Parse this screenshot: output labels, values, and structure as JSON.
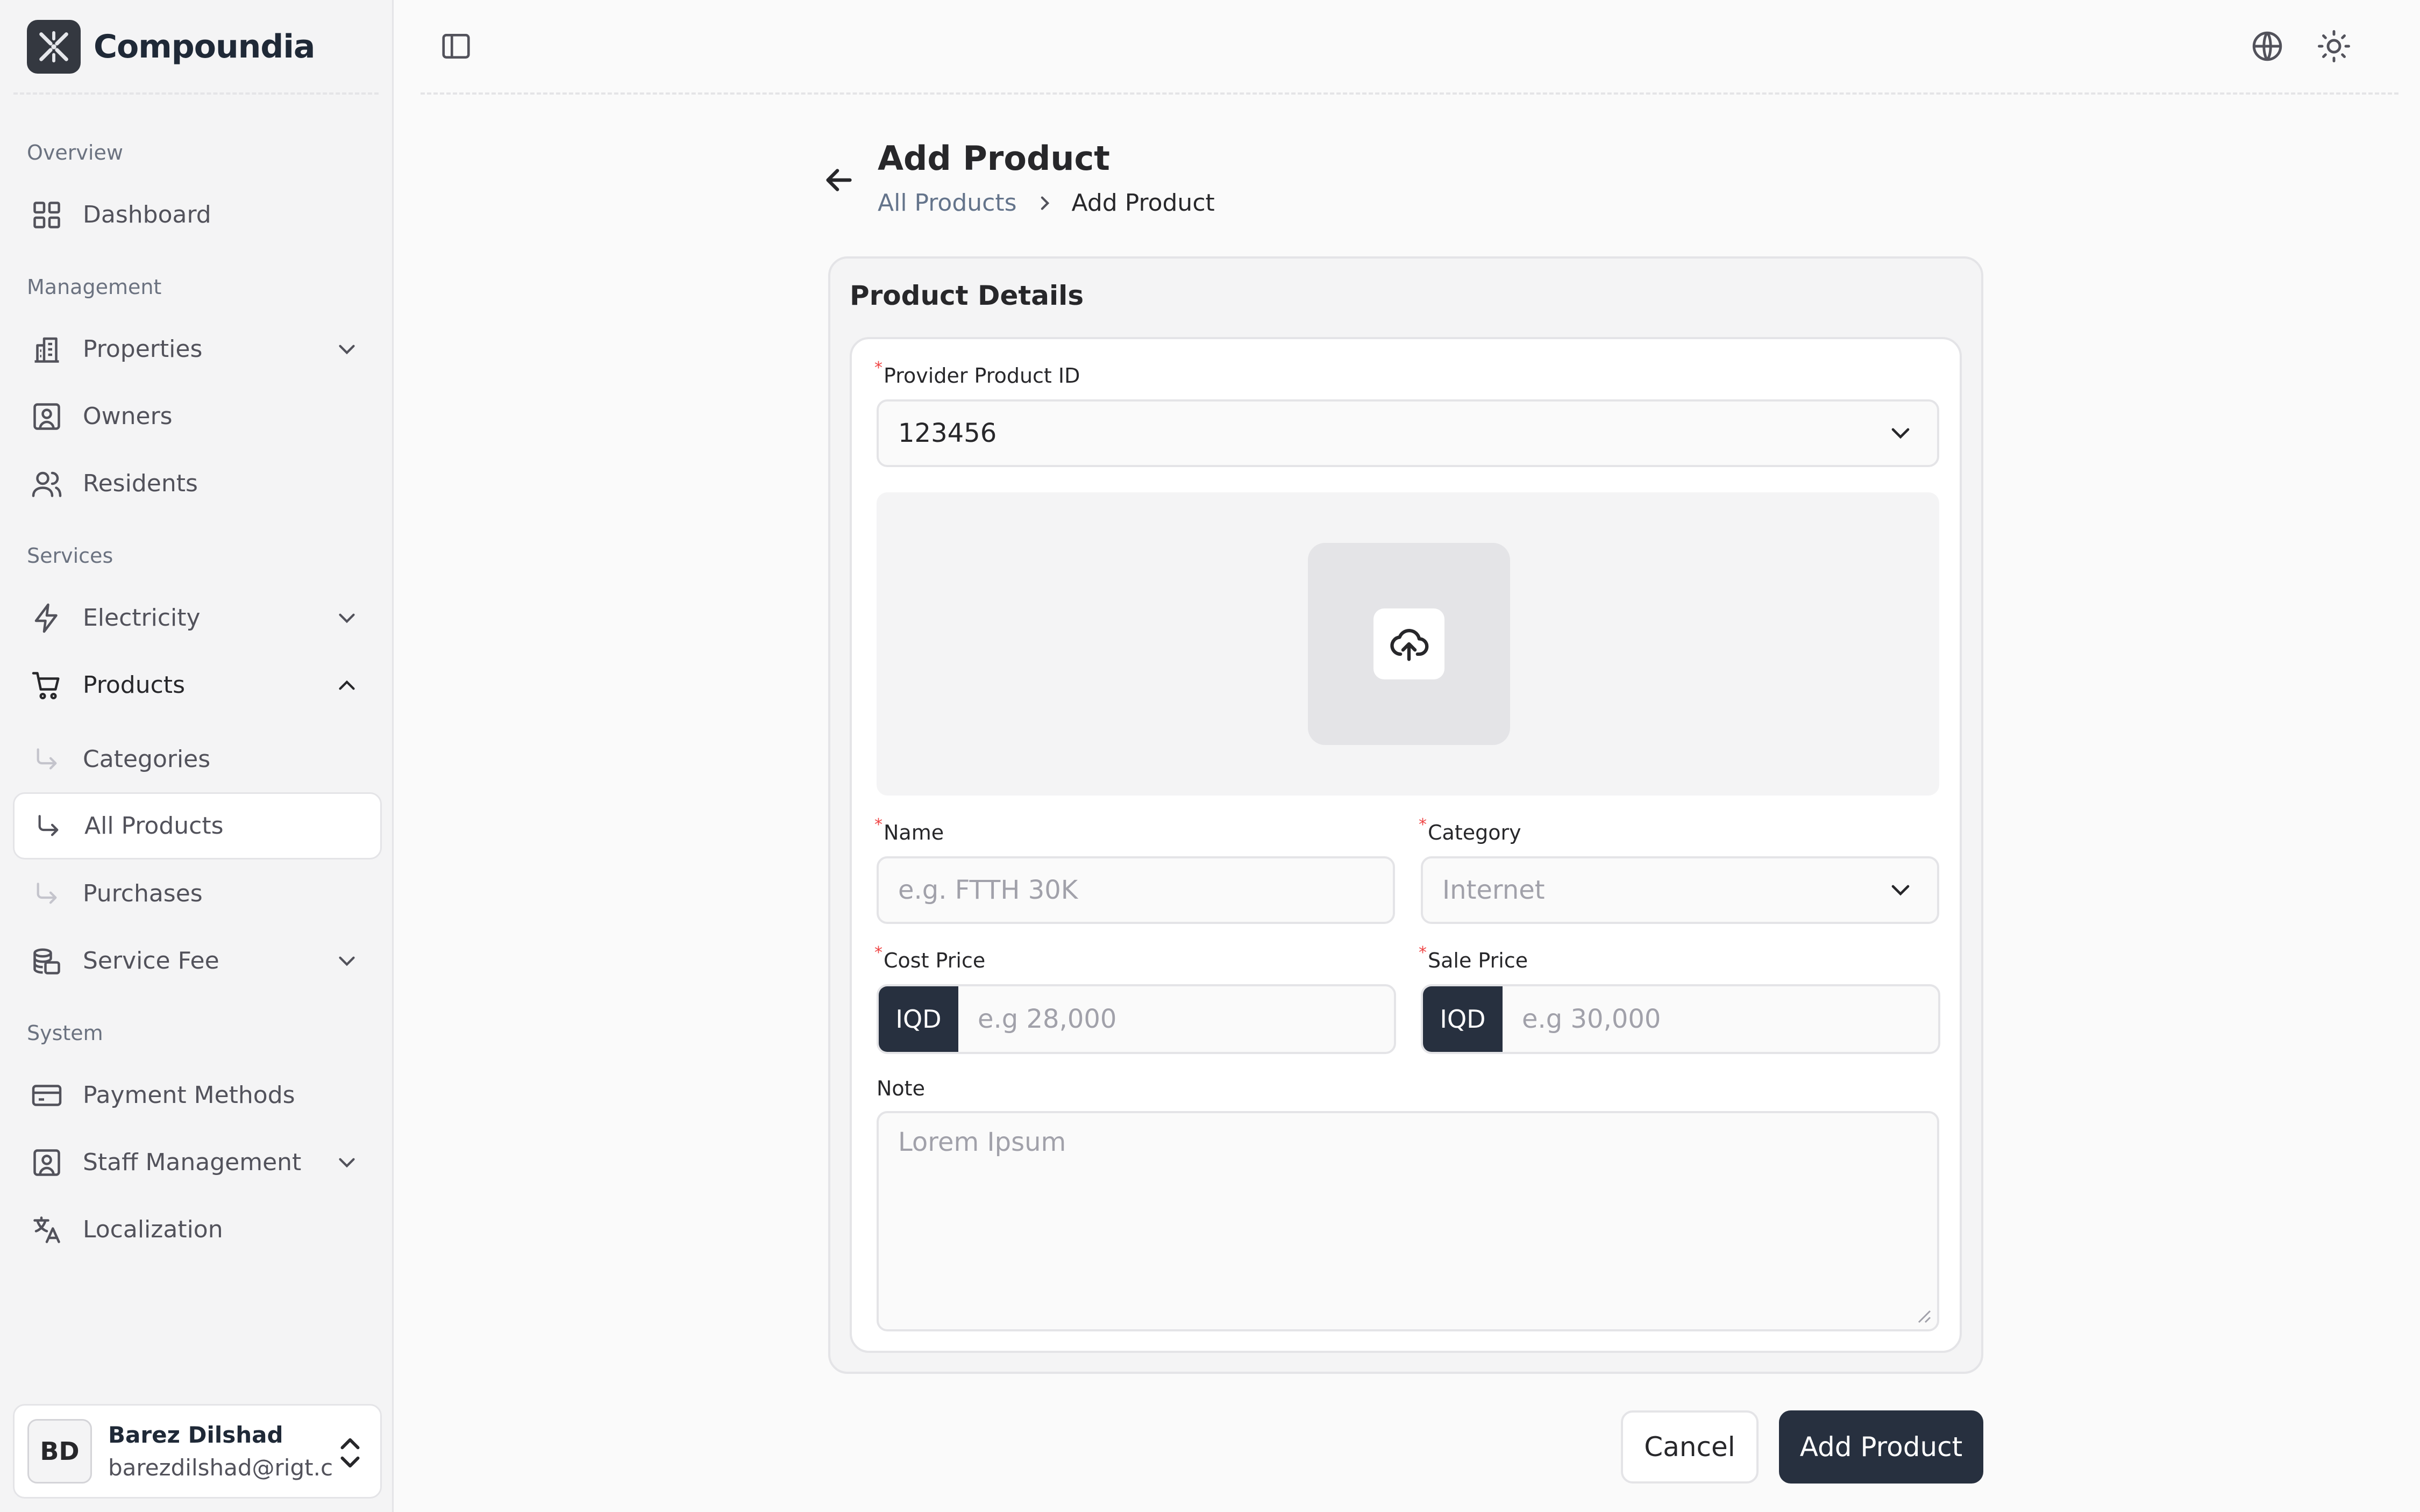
{
  "brand": {
    "name": "Compoundia"
  },
  "sidebar": {
    "sections": [
      {
        "title": "Overview"
      },
      {
        "title": "Management"
      },
      {
        "title": "Services"
      },
      {
        "title": "System"
      }
    ],
    "items": {
      "dashboard": "Dashboard",
      "properties": "Properties",
      "owners": "Owners",
      "residents": "Residents",
      "electricity": "Electricity",
      "products": "Products",
      "categories": "Categories",
      "all_products": "All Products",
      "purchases": "Purchases",
      "service_fee": "Service Fee",
      "payment_methods": "Payment Methods",
      "staff_management": "Staff Management",
      "localization": "Localization"
    },
    "user": {
      "initials": "BD",
      "name": "Barez Dilshad",
      "email": "barezdilshad@rigt.c..."
    }
  },
  "page": {
    "title": "Add Product",
    "breadcrumb": [
      "All Products",
      "Add Product"
    ]
  },
  "form": {
    "section_title": "Product Details",
    "provider_product_id": {
      "label": "Provider Product ID",
      "value": "123456"
    },
    "name": {
      "label": "Name",
      "placeholder": "e.g. FTTH 30K"
    },
    "category": {
      "label": "Category",
      "value": "Internet"
    },
    "cost_price": {
      "label": "Cost Price",
      "currency": "IQD",
      "placeholder": "e.g 28,000"
    },
    "sale_price": {
      "label": "Sale Price",
      "currency": "IQD",
      "placeholder": "e.g 30,000"
    },
    "note": {
      "label": "Note",
      "placeholder": "Lorem Ipsum"
    },
    "required_mark": "*"
  },
  "actions": {
    "cancel": "Cancel",
    "submit": "Add Product"
  },
  "colors": {
    "primary": "#27303f",
    "required": "#ef4444",
    "sidebar_bg": "#f4f4f5"
  }
}
